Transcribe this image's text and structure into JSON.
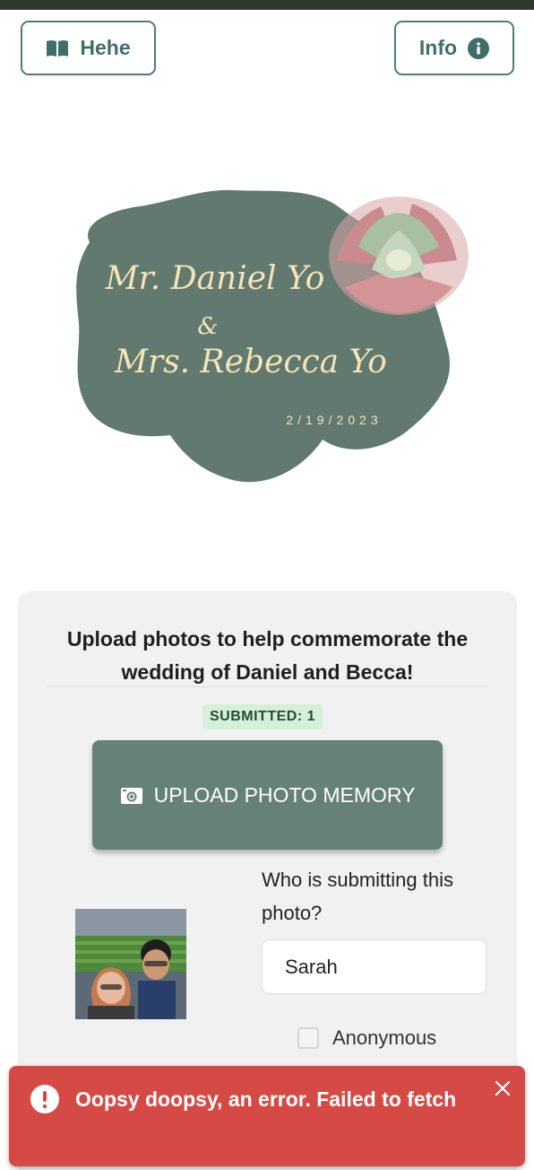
{
  "header": {
    "hehe_button": {
      "label": "Hehe",
      "icon": "book-open-icon"
    },
    "info_button": {
      "label": "Info",
      "icon": "info-circle-icon"
    }
  },
  "logo": {
    "line1": "Mr. Daniel Yo",
    "ampersand": "&",
    "line2": "Mrs. Rebecca Yo",
    "date": "2/19/2023"
  },
  "card": {
    "title": "Upload photos to help commemorate the wedding of Daniel and Becca!",
    "badge": "SUBMITTED: 1",
    "upload_button": {
      "label": "UPLOAD PHOTO MEMORY",
      "icon": "camera-icon"
    },
    "who_label": "Who is submitting this photo?",
    "name_value": "Sarah",
    "anonymous_label": "Anonymous"
  },
  "toast": {
    "message": "Oopsy doopsy, an error. Failed to fetch",
    "icon": "alert-circle-icon",
    "close_icon": "close-icon"
  },
  "colors": {
    "accent": "#4e7c74",
    "upload_button": "#668176",
    "badge_bg": "#d4f1d7",
    "error": "#d54a44"
  }
}
